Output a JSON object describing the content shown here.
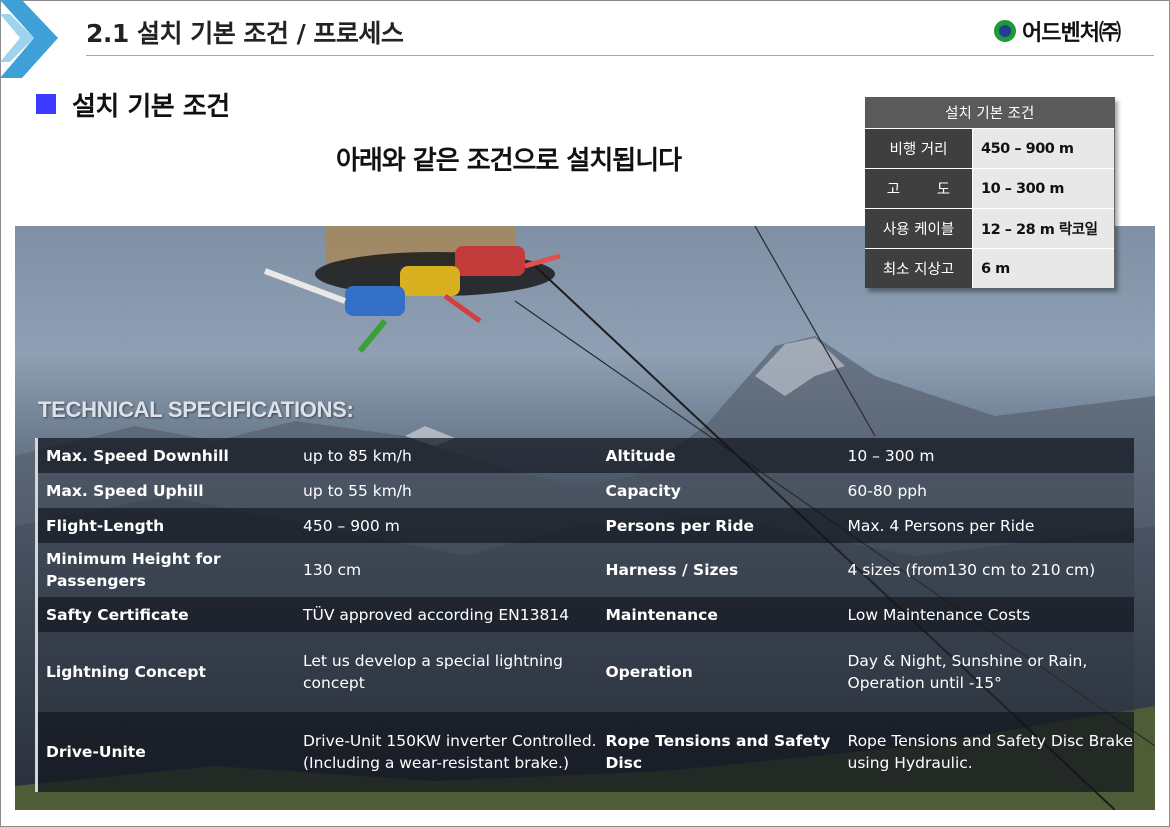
{
  "header": {
    "title": "2.1 설치 기본 조건 / 프로세스",
    "logo_text": "어드벤처㈜",
    "accent_color": "#3fa0d8"
  },
  "section": {
    "heading": "설치 기본 조건",
    "subtitle": "아래와 같은 조건으로 설치됩니다"
  },
  "summary_table": {
    "header": "설치 기본 조건",
    "rows": [
      {
        "label": "비행 거리",
        "value": "450 – 900 m"
      },
      {
        "label": "고        도",
        "value": "10 – 300 m"
      },
      {
        "label": "사용 케이블",
        "value": "12 – 28 m 락코일"
      },
      {
        "label": "최소 지상고",
        "value": "6 m"
      }
    ]
  },
  "specs": {
    "heading": "TECHNICAL SPECIFICATIONS:",
    "rows": [
      {
        "k1": "Max. Speed Downhill",
        "v1": "up to 85 km/h",
        "k2": "Altitude",
        "v2": "10 – 300 m"
      },
      {
        "k1": "Max. Speed Uphill",
        "v1": "up to 55 km/h",
        "k2": "Capacity",
        "v2": "60-80 pph"
      },
      {
        "k1": "Flight-Length",
        "v1": "450 – 900 m",
        "k2": "Persons per Ride",
        "v2": "Max. 4 Persons per Ride"
      },
      {
        "k1": "Minimum Height for Passengers",
        "v1": "130 cm",
        "k2": "Harness / Sizes",
        "v2": "4 sizes (from130 cm to 210 cm)"
      },
      {
        "k1": "Safty Certificate",
        "v1": "TÜV approved according  EN13814",
        "k2": "Maintenance",
        "v2": "Low Maintenance Costs"
      },
      {
        "k1": "Lightning Concept",
        "v1": "Let us develop a special lightning concept",
        "k2": "Operation",
        "v2": "Day & Night, Sunshine or Rain, Operation until -15°"
      },
      {
        "k1": "Drive-Unite",
        "v1": "Drive-Unit 150KW inverter Controlled. (Including a wear-resistant brake.)",
        "k2": "Rope Tensions and Safety Disc",
        "v2": "Rope Tensions and Safety Disc Brake using Hydraulic."
      }
    ]
  }
}
